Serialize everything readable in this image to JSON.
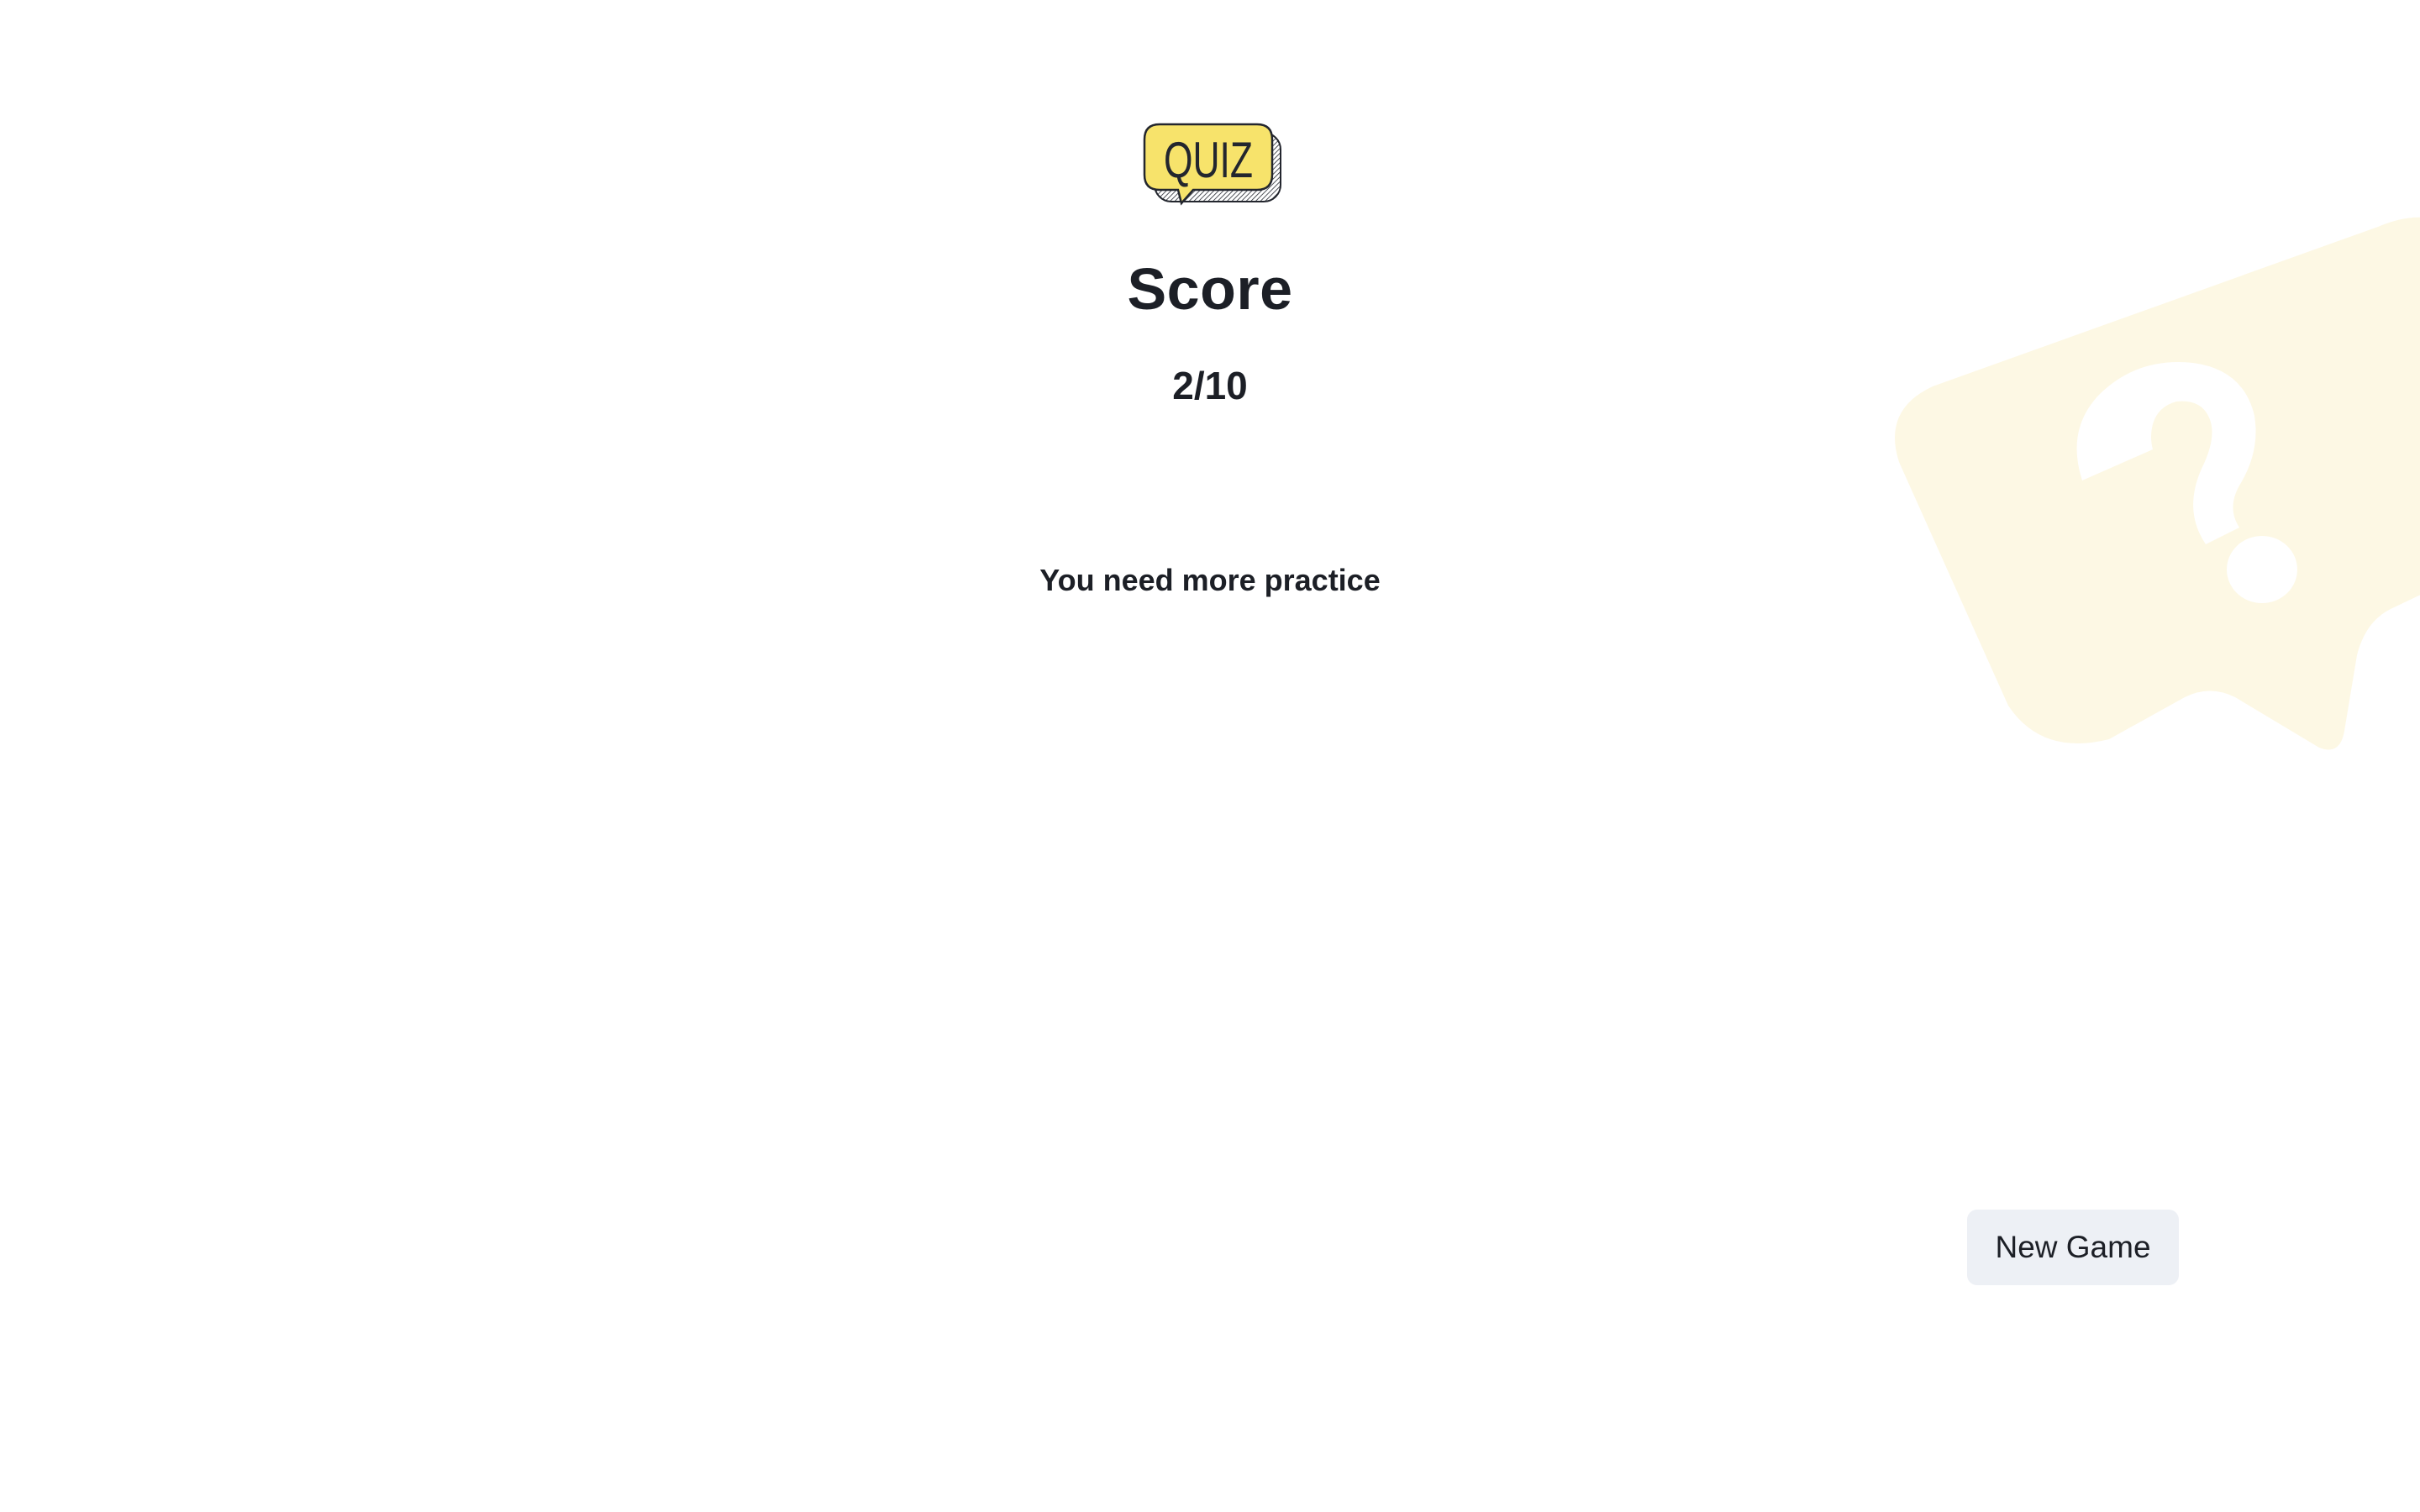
{
  "logo": {
    "text": "QUIZ",
    "fill_color": "#f7e36b",
    "outline_color": "#23262e"
  },
  "result": {
    "title": "Score",
    "score": "2/10",
    "message": "You need more practice"
  },
  "actions": {
    "new_game_label": "New Game"
  },
  "decoration": {
    "icon": "question-bubble-icon",
    "color": "#fdf8e4"
  }
}
